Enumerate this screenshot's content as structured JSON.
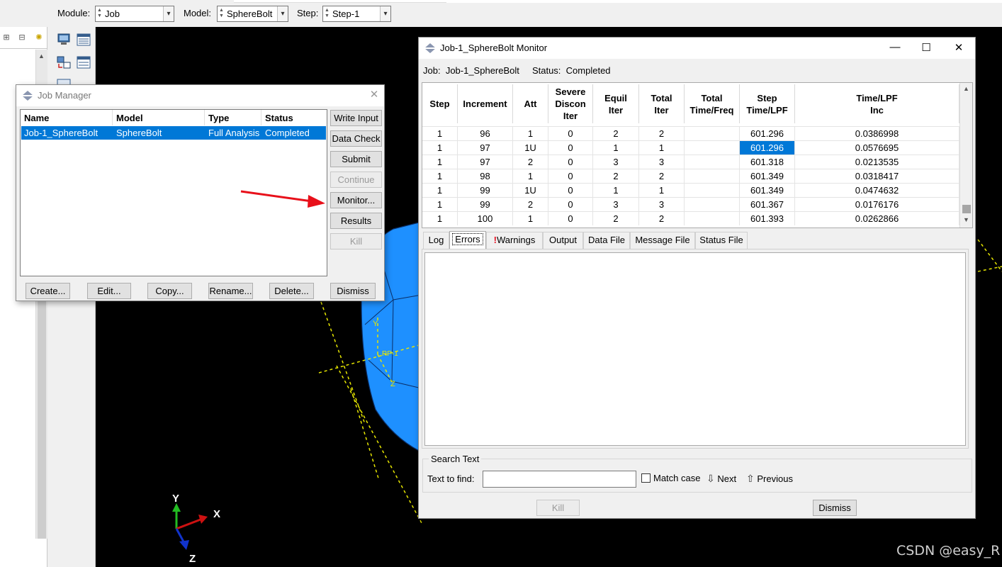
{
  "context_bar": {
    "module_label": "Module:",
    "module_value": "Job",
    "model_label": "Model:",
    "model_value": "SphereBolt",
    "step_label": "Step:",
    "step_value": "Step-1"
  },
  "viewport": {
    "triad": {
      "y": "Y",
      "x": "X",
      "z": "Z"
    },
    "rp_axis": {
      "y": "Y",
      "z": "Z",
      "rp": "RP-1"
    }
  },
  "job_manager": {
    "title": "Job Manager",
    "columns": [
      "Name",
      "Model",
      "Type",
      "Status"
    ],
    "rows": [
      {
        "name": "Job-1_SphereBolt",
        "model": "SphereBolt",
        "type": "Full Analysis",
        "status": "Completed"
      }
    ],
    "side_buttons": {
      "write_input": "Write Input",
      "data_check": "Data Check",
      "submit": "Submit",
      "continue": "Continue",
      "monitor": "Monitor...",
      "results": "Results",
      "kill": "Kill"
    },
    "bottom_buttons": {
      "create": "Create...",
      "edit": "Edit...",
      "copy": "Copy...",
      "rename": "Rename...",
      "delete": "Delete...",
      "dismiss": "Dismiss"
    }
  },
  "monitor": {
    "title": "Job-1_SphereBolt Monitor",
    "job_label": "Job:",
    "job_value": "Job-1_SphereBolt",
    "status_label": "Status:",
    "status_value": "Completed",
    "columns": [
      "Step",
      "Increment",
      "Att",
      "Severe\nDiscon\nIter",
      "Equil\nIter",
      "Total\nIter",
      "Total\nTime/Freq",
      "Step\nTime/LPF",
      "Time/LPF\nInc"
    ],
    "rows": [
      [
        "1",
        "96",
        "1",
        "0",
        "2",
        "2",
        "",
        "601.296",
        "0.0386998"
      ],
      [
        "1",
        "97",
        "1U",
        "0",
        "1",
        "1",
        "",
        "601.296",
        "0.0576695"
      ],
      [
        "1",
        "97",
        "2",
        "0",
        "3",
        "3",
        "",
        "601.318",
        "0.0213535"
      ],
      [
        "1",
        "98",
        "1",
        "0",
        "2",
        "2",
        "",
        "601.349",
        "0.0318417"
      ],
      [
        "1",
        "99",
        "1U",
        "0",
        "1",
        "1",
        "",
        "601.349",
        "0.0474632"
      ],
      [
        "1",
        "99",
        "2",
        "0",
        "3",
        "3",
        "",
        "601.367",
        "0.0176176"
      ],
      [
        "1",
        "100",
        "1",
        "0",
        "2",
        "2",
        "",
        "601.393",
        "0.0262866"
      ]
    ],
    "tabs": {
      "log": "Log",
      "errors": "Errors",
      "warnings_mark": "!",
      "warnings": "Warnings",
      "output": "Output",
      "data_file": "Data File",
      "message_file": "Message File",
      "status_file": "Status File"
    },
    "search": {
      "group_label": "Search Text",
      "find_label": "Text to find:",
      "find_value": "",
      "match_case": "Match case",
      "next": "Next",
      "previous": "Previous"
    },
    "buttons": {
      "kill": "Kill",
      "dismiss": "Dismiss"
    }
  },
  "watermark": "CSDN @easy_R",
  "colors": {
    "selection": "#0078d7",
    "viewport_bg": "#000000",
    "sphere": "#1e90ff",
    "annotation_arrow": "#e8101a",
    "construction_lines": "#e6e600"
  }
}
